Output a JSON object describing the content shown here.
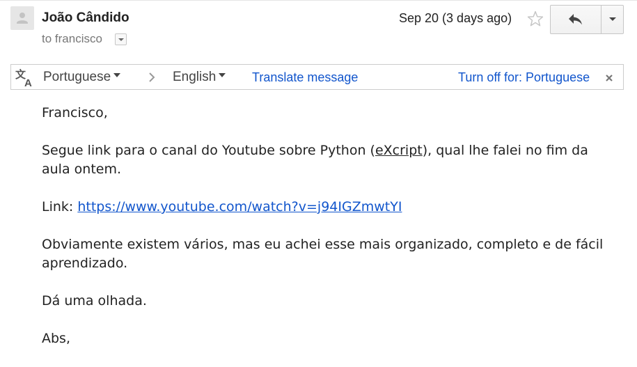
{
  "header": {
    "sender": "João Cândido",
    "recipient": "to francisco",
    "date": "Sep 20 (3 days ago)",
    "icons": {
      "avatar": "person-icon",
      "star": "star-icon",
      "reply": "reply-icon",
      "more": "chevron-down-icon"
    }
  },
  "translate_bar": {
    "from_lang": "Portuguese",
    "to_lang": "English",
    "translate_label": "Translate message",
    "turn_off_label": "Turn off for: Portuguese",
    "icons": {
      "translate": "translate-icon",
      "arrow": "chevron-right-icon",
      "close": "close-icon"
    }
  },
  "message": {
    "greeting": "Francisco,",
    "p1_before": "Segue link para o canal do Youtube sobre Python (",
    "p1_link": "eXcript",
    "p1_after": "), qual lhe falei no fim da aula ontem.",
    "p2_label": "Link: ",
    "p2_url": "https://www.youtube.com/watch?v=j94IGZmwtYI",
    "p3": "Obviamente existem vários, mas eu achei esse mais organizado, completo e de fácil aprendizado.",
    "p4": "Dá uma olhada.",
    "signoff": "Abs,"
  },
  "colors": {
    "link": "#1155cc",
    "text": "#222222",
    "muted": "#777777"
  }
}
